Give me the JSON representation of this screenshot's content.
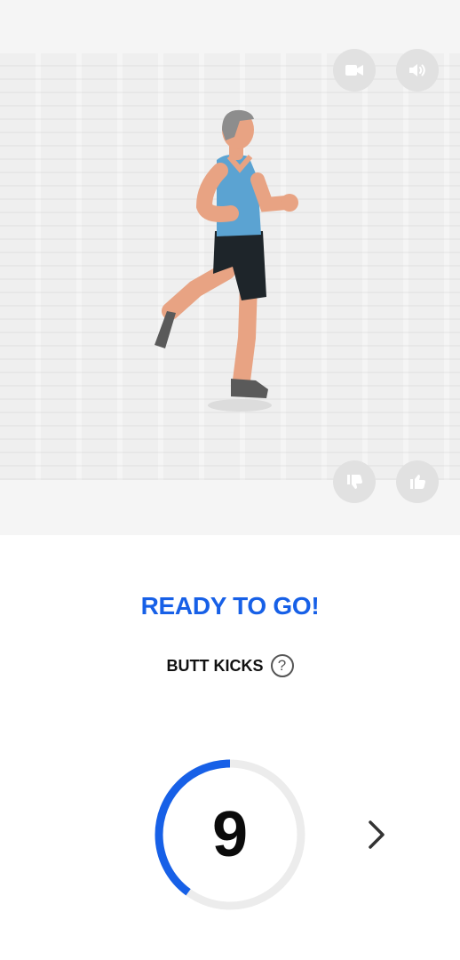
{
  "media": {
    "video_icon": "video-camera-icon",
    "sound_icon": "volume-icon",
    "dislike_icon": "thumbs-down-icon",
    "like_icon": "thumbs-up-icon"
  },
  "status": {
    "title": "READY TO GO!"
  },
  "exercise": {
    "name": "BUTT KICKS",
    "help_symbol": "?"
  },
  "countdown": {
    "value": "9",
    "progress": 0.4,
    "accent": "#1760e7",
    "track": "#ececec"
  },
  "colors": {
    "accent": "#1760e7"
  }
}
